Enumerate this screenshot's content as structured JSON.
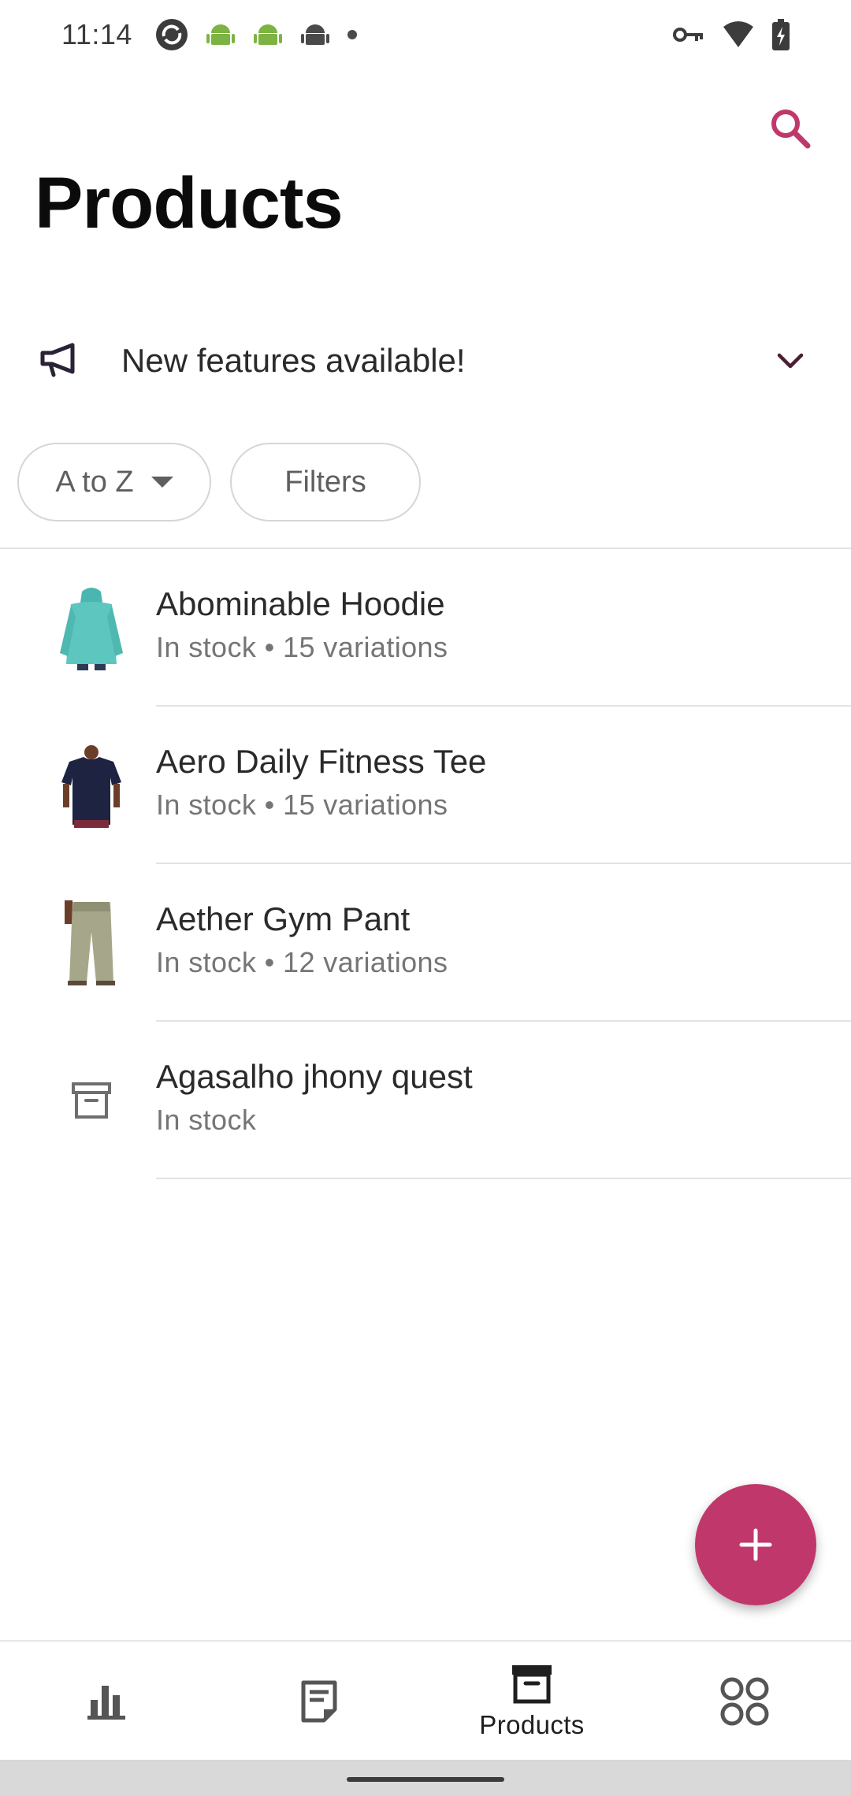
{
  "status_bar": {
    "time": "11:14",
    "left_icons": [
      "sync-icon",
      "android-icon",
      "android-icon",
      "android-icon",
      "dot-icon"
    ],
    "right_icons": [
      "vpn-key-icon",
      "wifi-icon",
      "battery-charging-icon"
    ]
  },
  "header": {
    "title": "Products",
    "search_icon": "search-icon",
    "accent_color": "#c0386b"
  },
  "banner": {
    "icon": "megaphone-icon",
    "text": "New features available!",
    "chevron_icon": "chevron-down-icon"
  },
  "chips": {
    "sort_label": "A to Z",
    "filters_label": "Filters"
  },
  "products": [
    {
      "name": "Abominable Hoodie",
      "meta": "In stock • 15 variations",
      "thumb": "teal-hoodie"
    },
    {
      "name": "Aero Daily Fitness Tee",
      "meta": "In stock • 15 variations",
      "thumb": "navy-tee"
    },
    {
      "name": "Aether Gym Pant",
      "meta": "In stock • 12 variations",
      "thumb": "khaki-pant"
    },
    {
      "name": "Agasalho jhony quest",
      "meta": "In stock",
      "thumb": "archive-icon"
    }
  ],
  "fab": {
    "icon": "plus-icon"
  },
  "bottom_nav": {
    "items": [
      {
        "icon": "bar-chart-icon",
        "label": ""
      },
      {
        "icon": "orders-icon",
        "label": ""
      },
      {
        "icon": "products-box-icon",
        "label": "Products"
      },
      {
        "icon": "more-grid-icon",
        "label": ""
      }
    ],
    "selected": "Products"
  }
}
